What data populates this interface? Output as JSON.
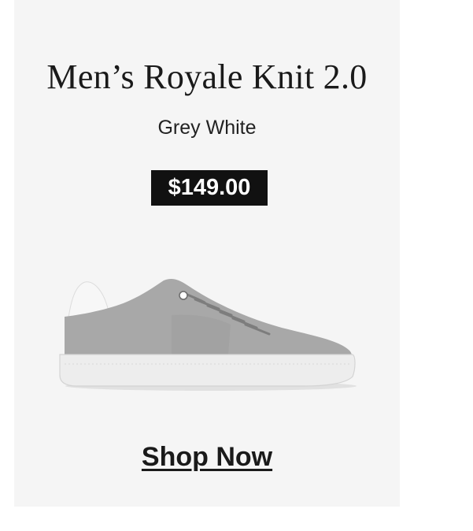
{
  "product": {
    "title": "Men’s Royale Knit 2.0",
    "color": "Grey White",
    "price": "$149.00",
    "image_icon": "sneaker-image"
  },
  "cta": {
    "label": "Shop Now"
  },
  "colors": {
    "card_background": "#f5f5f5",
    "price_badge": "#111111",
    "shoe_upper": "#a9a9a9",
    "shoe_sole": "#ececec"
  }
}
